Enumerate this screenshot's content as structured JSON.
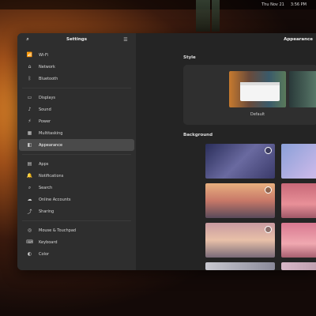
{
  "topbar": {
    "items": [
      "Thu Nov 21",
      "3:56 PM"
    ]
  },
  "settings": {
    "title": "Settings",
    "content_title": "Appearance",
    "sidebar_items": [
      {
        "label": "Wi-Fi",
        "icon": "wifi-icon",
        "glyph": "📶"
      },
      {
        "label": "Network",
        "icon": "network-icon",
        "glyph": "⌂"
      },
      {
        "label": "Bluetooth",
        "icon": "bluetooth-icon",
        "glyph": "ᛒ"
      },
      {
        "label": "Displays",
        "icon": "display-icon",
        "glyph": "▭"
      },
      {
        "label": "Sound",
        "icon": "sound-icon",
        "glyph": "♪"
      },
      {
        "label": "Power",
        "icon": "power-icon",
        "glyph": "⚡"
      },
      {
        "label": "Multitasking",
        "icon": "multitasking-icon",
        "glyph": "▦"
      },
      {
        "label": "Appearance",
        "icon": "appearance-icon",
        "glyph": "◧",
        "active": true
      },
      {
        "label": "Apps",
        "icon": "apps-icon",
        "glyph": "▤"
      },
      {
        "label": "Notifications",
        "icon": "notifications-icon",
        "glyph": "🔔"
      },
      {
        "label": "Search",
        "icon": "search-icon",
        "glyph": "⌕"
      },
      {
        "label": "Online Accounts",
        "icon": "online-accounts-icon",
        "glyph": "☁"
      },
      {
        "label": "Sharing",
        "icon": "sharing-icon",
        "glyph": "⤴"
      },
      {
        "label": "Mouse & Touchpad",
        "icon": "mouse-icon",
        "glyph": "◎"
      },
      {
        "label": "Keyboard",
        "icon": "keyboard-icon",
        "glyph": "⌨"
      },
      {
        "label": "Color",
        "icon": "color-icon",
        "glyph": "◐"
      }
    ],
    "style_label": "Style",
    "style_option": "Default",
    "background_label": "Background"
  },
  "colors": {
    "window_bg": "#242424",
    "sidebar_bg": "#2e2e2e",
    "active_item": "#4a4a4a"
  }
}
